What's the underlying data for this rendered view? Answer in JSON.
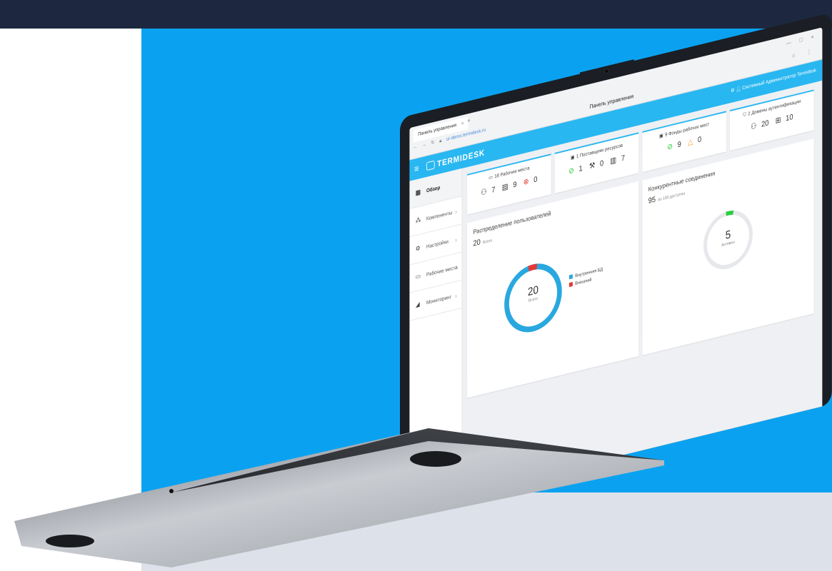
{
  "browser": {
    "tab_label": "Панель управления",
    "tab_close": "×",
    "new_tab": "+",
    "url": "ui-demo.termidesk.ru",
    "window_controls": "— □ ×"
  },
  "app": {
    "logo_text": "TERMIDESK",
    "page_title": "Панель управления",
    "user_label": "Системный Администратор Termidesk"
  },
  "sidebar": {
    "items": [
      {
        "label": "Обзор",
        "icon": "dashboard-icon"
      },
      {
        "label": "Компоненты",
        "icon": "components-icon"
      },
      {
        "label": "Настройки",
        "icon": "settings-icon"
      },
      {
        "label": "Рабочие места",
        "icon": "monitor-icon"
      },
      {
        "label": "Мониторинг",
        "icon": "chart-icon"
      }
    ]
  },
  "stats": [
    {
      "title": "18 Рабочие места",
      "values": [
        {
          "icon": "users-icon",
          "text": "7"
        },
        {
          "icon": "server-icon",
          "text": "9"
        },
        {
          "icon": "error-icon",
          "text": "0"
        }
      ]
    },
    {
      "title": "1 Поставщики ресурсов",
      "values": [
        {
          "icon": "ok-icon",
          "text": "1"
        },
        {
          "icon": "tools-icon",
          "text": "0"
        },
        {
          "icon": "storage-icon",
          "text": "7"
        }
      ]
    },
    {
      "title": "9 Фонды рабочих мест",
      "values": [
        {
          "icon": "ok-icon",
          "text": "9"
        },
        {
          "icon": "warning-icon",
          "text": "0"
        }
      ]
    },
    {
      "title": "2 Домены аутентификации",
      "values": [
        {
          "icon": "users-icon",
          "text": "20"
        },
        {
          "icon": "groups-icon",
          "text": "10"
        }
      ]
    }
  ],
  "users_panel": {
    "title": "Распределение пользователей",
    "total": "20",
    "total_caption": "Всего",
    "center_value": "20",
    "center_caption": "Всего",
    "legend": [
      {
        "label": "Внутренняя БД",
        "color": "#29a8e0"
      },
      {
        "label": "Внешний",
        "color": "#e53935"
      }
    ]
  },
  "connections_panel": {
    "title": "Конкурентные соединения",
    "total": "95",
    "total_caption": "из 100 доступно",
    "center_value": "5",
    "center_caption": "Активно"
  }
}
